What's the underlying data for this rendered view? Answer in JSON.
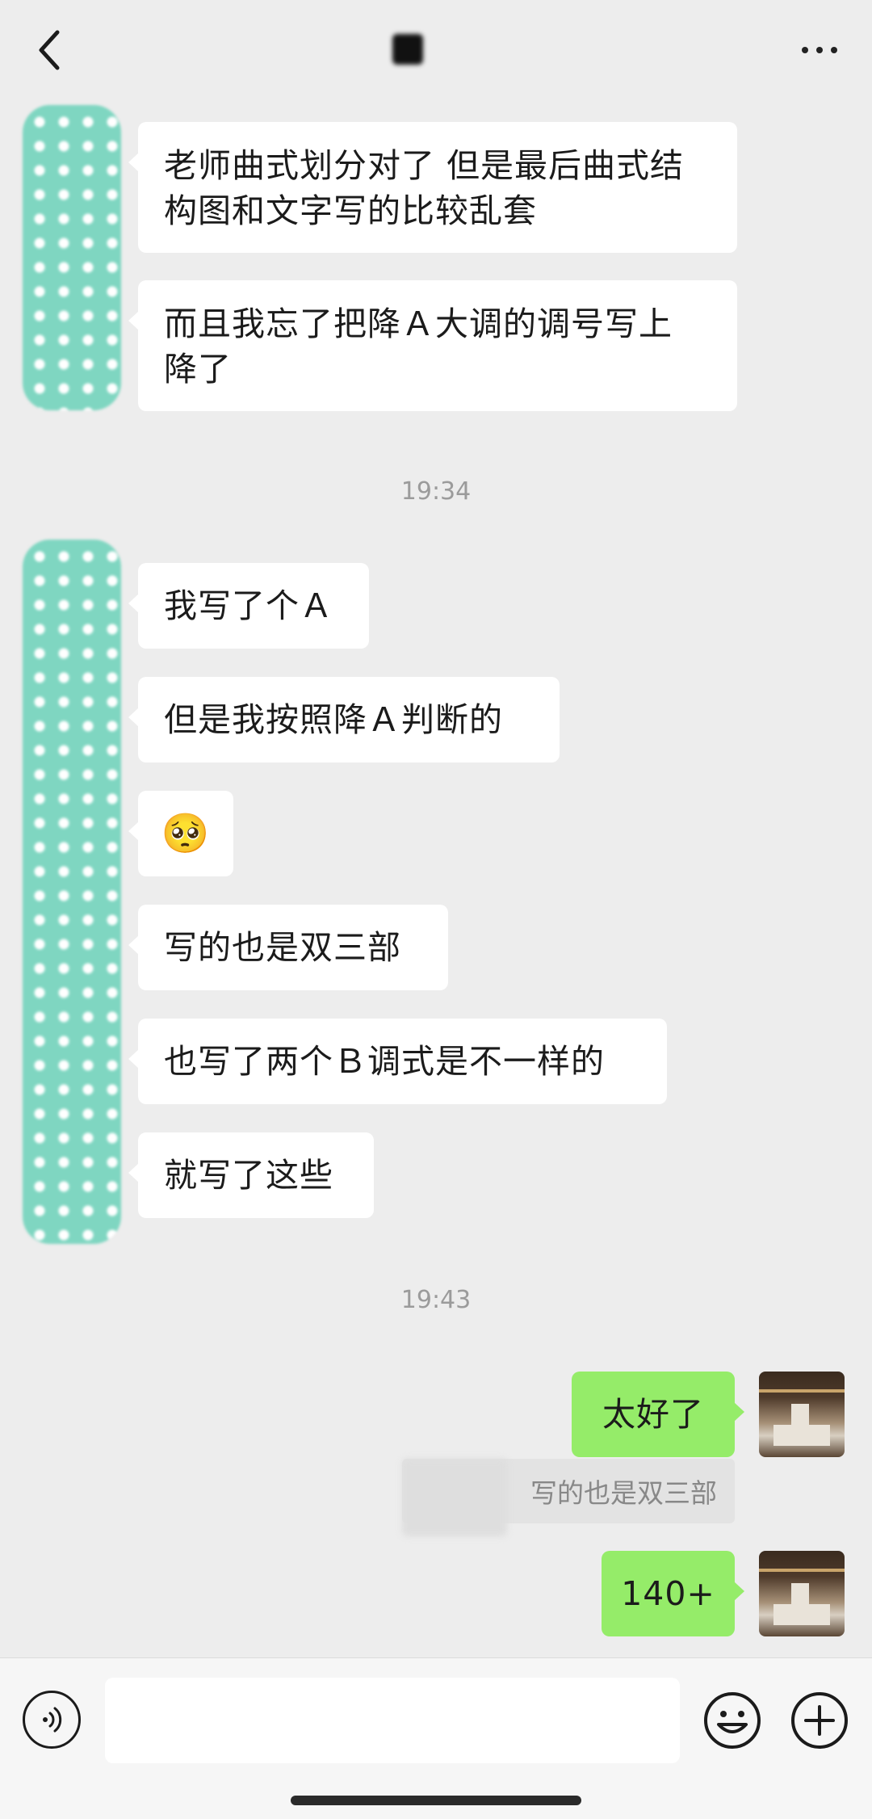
{
  "header": {
    "back_icon": "chevron-left-icon",
    "title": "",
    "more_icon": "more-dots-icon"
  },
  "messages": {
    "m1": "老师曲式划分对了 但是最后曲式结\n构图和文字写的比较乱套",
    "m2": "而且我忘了把降Ａ大调的调号写上\n降了",
    "time1": "19:34",
    "m3": "我写了个Ａ",
    "m4": "但是我按照降Ａ判断的",
    "m5_emoji": "🥺",
    "m6": "写的也是双三部",
    "m7": "也写了两个Ｂ调式是不一样的",
    "m8": "就写了这些",
    "time2": "19:43",
    "r1": "太好了",
    "r1_quote": "写的也是双三部",
    "r2": "140+"
  },
  "input_bar": {
    "voice_icon": "voice-icon",
    "text_value": "",
    "emoji_icon": "smile-icon",
    "plus_icon": "plus-circle-icon"
  },
  "colors": {
    "background": "#ededed",
    "incoming_bubble": "#ffffff",
    "outgoing_bubble": "#95ec69",
    "timestamp": "#9b9b9b"
  }
}
